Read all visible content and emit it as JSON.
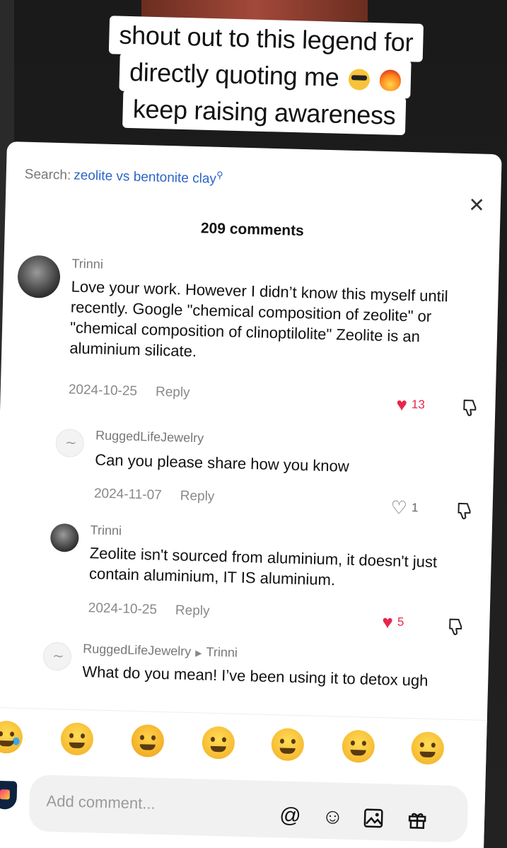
{
  "caption": {
    "lines": [
      "shout out to this legend for",
      "directly quoting me",
      "keep raising awareness"
    ]
  },
  "search": {
    "label": "Search:",
    "term": "zeolite vs bentonite clay"
  },
  "header": {
    "title": "209 comments",
    "close": "✕"
  },
  "comments": [
    {
      "user": "Trinni",
      "text": "Love your work. However I didn’t know this myself until recently. Google \"chemical composition of zeolite\" or \"chemical composition of clinoptilolite\" Zeolite is an aluminium silicate.",
      "date": "2024-10-25",
      "reply": "Reply",
      "likes": "13",
      "liked": true
    },
    {
      "user": "RuggedLifeJewelry",
      "text": "Can you please share how you know",
      "date": "2024-11-07",
      "reply": "Reply",
      "likes": "1",
      "liked": false
    },
    {
      "user": "Trinni",
      "text": "Zeolite isn't sourced from aluminium, it doesn't just contain aluminium, IT IS aluminium.",
      "date": "2024-10-25",
      "reply": "Reply",
      "likes": "5",
      "liked": true
    },
    {
      "user": "RuggedLifeJewelry",
      "reply_to": "Trinni",
      "text": "What do you mean! I’ve been using it to detox ugh"
    }
  ],
  "emoji_bar": [
    "crying-face",
    "grinning-face",
    "smiling-face-with-hearts",
    "tears-of-joy-face",
    "flushed-face",
    "smirking-face",
    "grinning-sweat-face"
  ],
  "input": {
    "placeholder": "Add comment...",
    "icons": [
      "@",
      "emoji-icon",
      "image-icon",
      "gift-icon"
    ]
  },
  "colors": {
    "accent_blue": "#2d63c8",
    "like_red": "#e8264b"
  }
}
